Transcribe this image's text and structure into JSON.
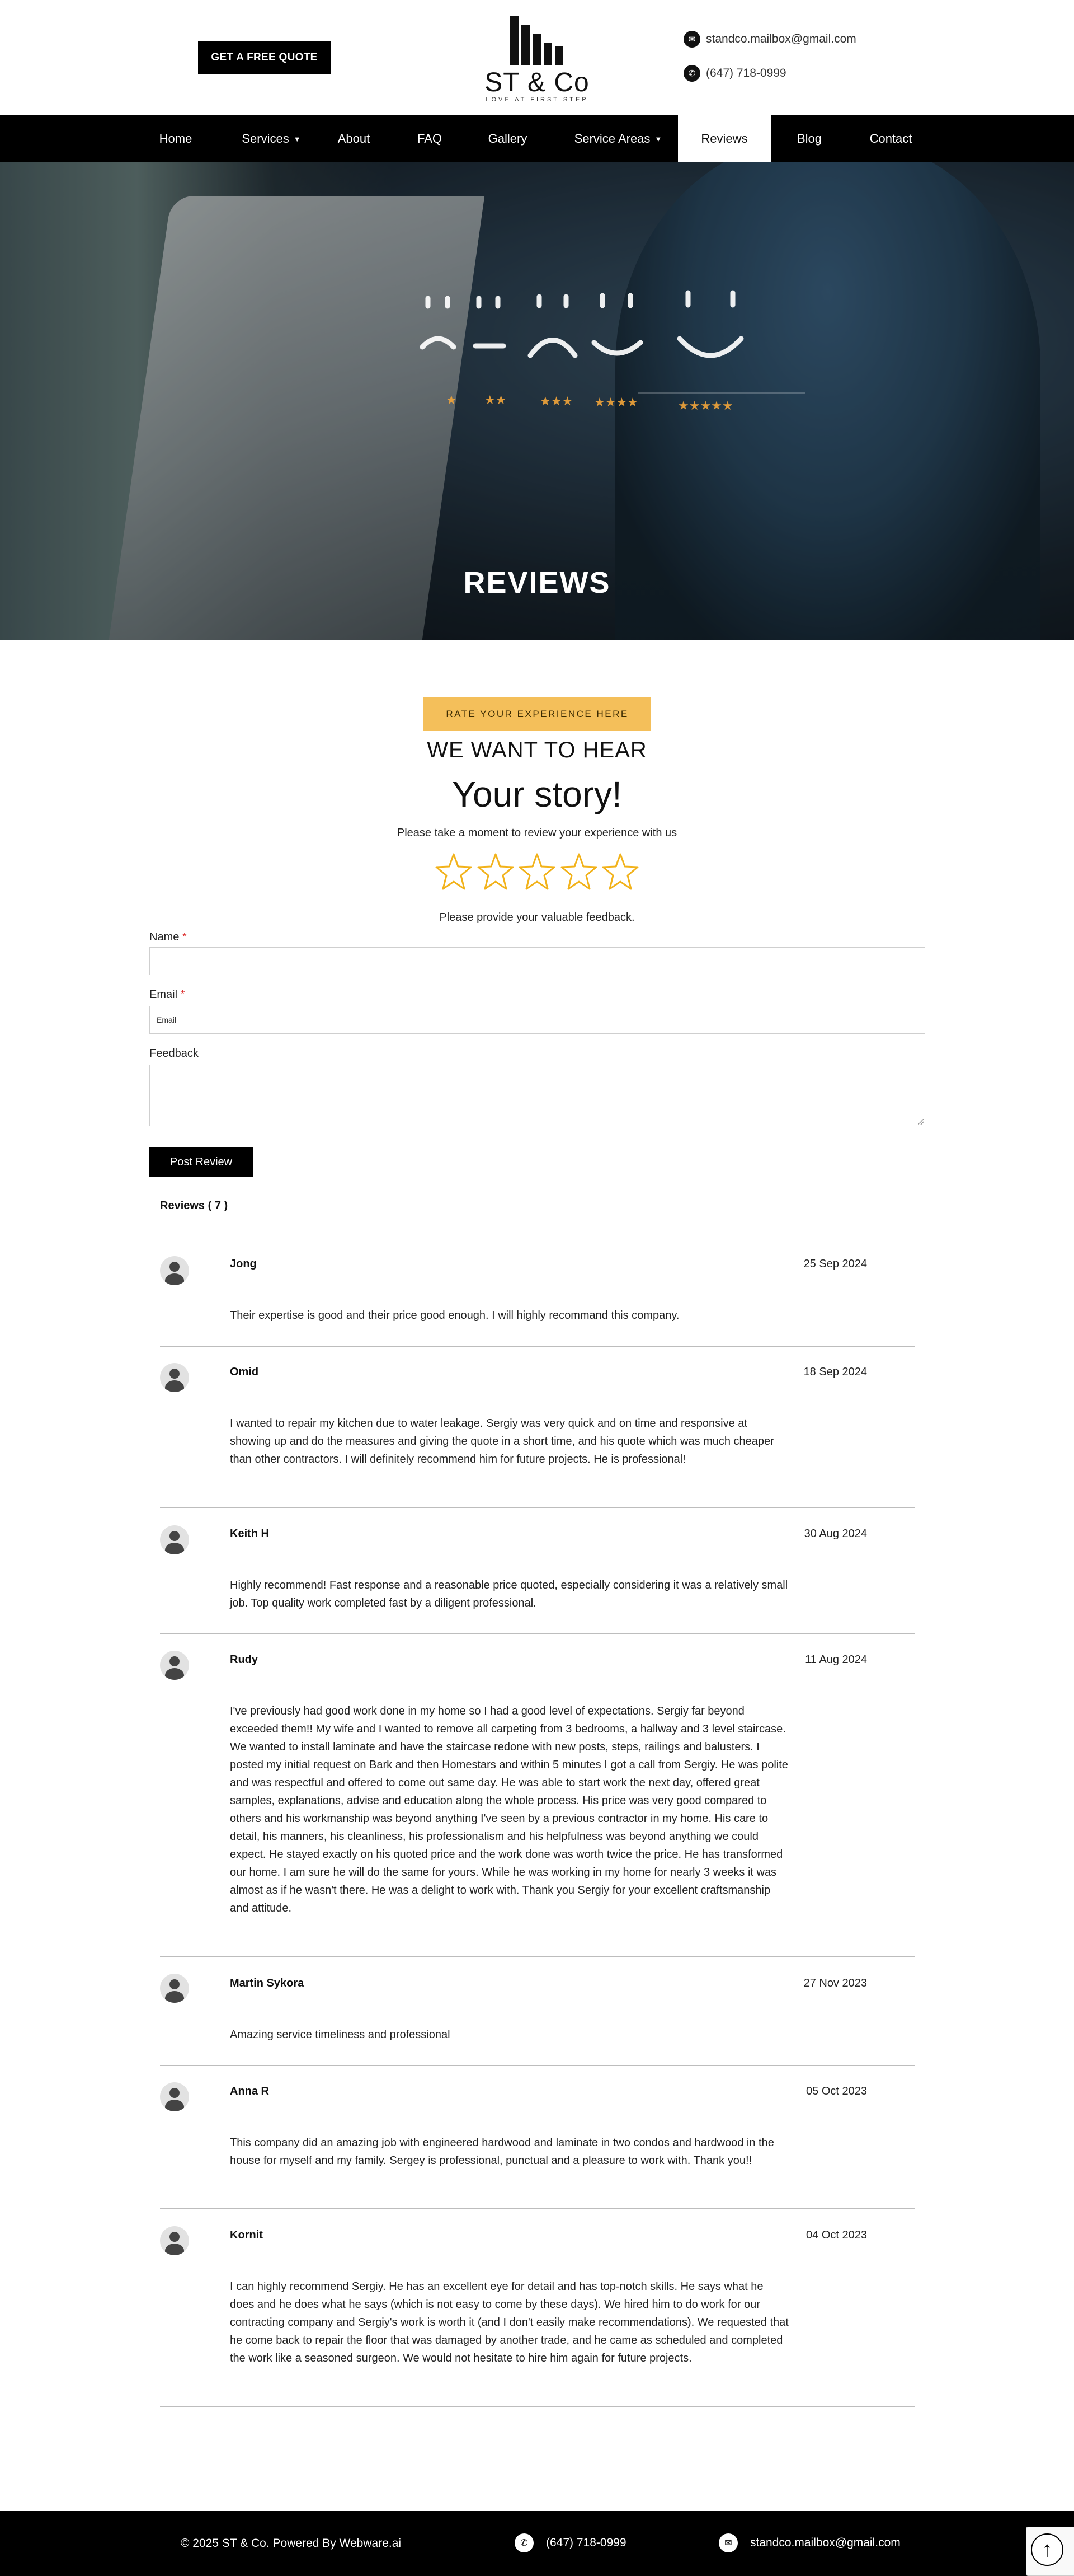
{
  "header": {
    "quote_button": "GET A FREE QUOTE",
    "logo_name": "ST & Co",
    "logo_tagline": "LOVE AT FIRST STEP",
    "email": "standco.mailbox@gmail.com",
    "phone": "(647) 718-0999"
  },
  "nav": {
    "items": [
      {
        "label": "Home"
      },
      {
        "label": "Services",
        "has_dropdown": true
      },
      {
        "label": "About"
      },
      {
        "label": "FAQ"
      },
      {
        "label": "Gallery"
      },
      {
        "label": "Service Areas",
        "has_dropdown": true
      },
      {
        "label": "Reviews",
        "active": true
      },
      {
        "label": "Blog"
      },
      {
        "label": "Contact"
      }
    ]
  },
  "hero": {
    "title": "REVIEWS"
  },
  "form": {
    "pill": "RATE YOUR EXPERIENCE HERE",
    "heading_small": "WE WANT TO HEAR",
    "heading_large": "Your story!",
    "intro": "Please take a moment to review your experience with us",
    "rating_value": 0,
    "rating_max": 5,
    "feedback_prompt": "Please provide your valuable feedback.",
    "name_label": "Name",
    "email_label": "Email",
    "email_placeholder": "Email",
    "feedback_label": "Feedback",
    "required_mark": "*",
    "submit": "Post Review"
  },
  "reviews": {
    "count_label": "Reviews ( 7 )",
    "items": [
      {
        "name": "Jong",
        "date": "25 Sep 2024",
        "text": "Their expertise is good and their price good enough. I will highly recommand this company."
      },
      {
        "name": "Omid",
        "date": "18 Sep 2024",
        "text": "I wanted to repair my kitchen due to water leakage. Sergiy was very quick and on time and responsive at showing up and do the measures and giving the quote in a short time, and his quote which was much cheaper than other contractors. I will definitely recommend him for future projects. He is professional!"
      },
      {
        "name": "Keith H",
        "date": "30 Aug 2024",
        "text": "Highly recommend! Fast response and a reasonable price quoted, especially considering it was a relatively small job. Top quality work completed fast by a diligent professional."
      },
      {
        "name": "Rudy",
        "date": "11 Aug 2024",
        "text": "I've previously had good work done in my home so I had a good level of expectations. Sergiy far beyond exceeded them!! My wife and I wanted to remove all carpeting from 3 bedrooms, a hallway and 3 level staircase. We wanted to install laminate and have the staircase redone with new posts, steps, railings and balusters. I posted my initial request on Bark and then Homestars and within 5 minutes I got a call from Sergiy. He was polite and was respectful and offered to come out same day. He was able to start work the next day, offered great samples, explanations, advise and education along the whole process. His price was very good compared to others and his workmanship was beyond anything I've seen by a previous contractor in my home. His care to detail, his manners, his cleanliness, his professionalism and his helpfulness was beyond anything we could expect. He stayed exactly on his quoted price and the work done was worth twice the price. He has transformed our home. I am sure he will do the same for yours. While he was working in my home for nearly 3 weeks it was almost as if he wasn't there. He was a delight to work with. Thank you Sergiy for your excellent craftsmanship and attitude."
      },
      {
        "name": "Martin Sykora",
        "date": "27 Nov 2023",
        "text": "Amazing service timeliness and professional"
      },
      {
        "name": "Anna R",
        "date": "05 Oct 2023",
        "text": "This company did an amazing job with engineered hardwood and laminate in two condos and hardwood in the house for myself and my family. Sergey is professional, punctual and a pleasure to work with. Thank you!!"
      },
      {
        "name": "Kornit",
        "date": "04 Oct 2023",
        "text": "I can highly recommend Sergiy. He has an excellent eye for detail and has top-notch skills. He says what he does and he does what he says (which is not easy to come by these days). We hired him to do work for our contracting company and Sergiy's work is worth it (and I don't easily make recommendations). We requested that he come back to repair the floor that was damaged by another trade, and he came as scheduled and completed the work like a seasoned surgeon. We would not hesitate to hire him again for future projects."
      }
    ]
  },
  "footer": {
    "copyright": "© 2025 ST & Co. Powered By Webware.ai",
    "phone": "(647) 718-0999",
    "email": "standco.mailbox@gmail.com"
  },
  "colors": {
    "accent": "#f4bf5a",
    "star_outline": "#f2b21a",
    "nav_bg": "#000000"
  },
  "icons": {
    "email": "envelope-icon",
    "phone": "phone-icon",
    "dropdown": "caret-down-icon",
    "star": "star-outline-icon",
    "avatar": "user-avatar-icon",
    "back_to_top": "arrow-up-icon"
  }
}
